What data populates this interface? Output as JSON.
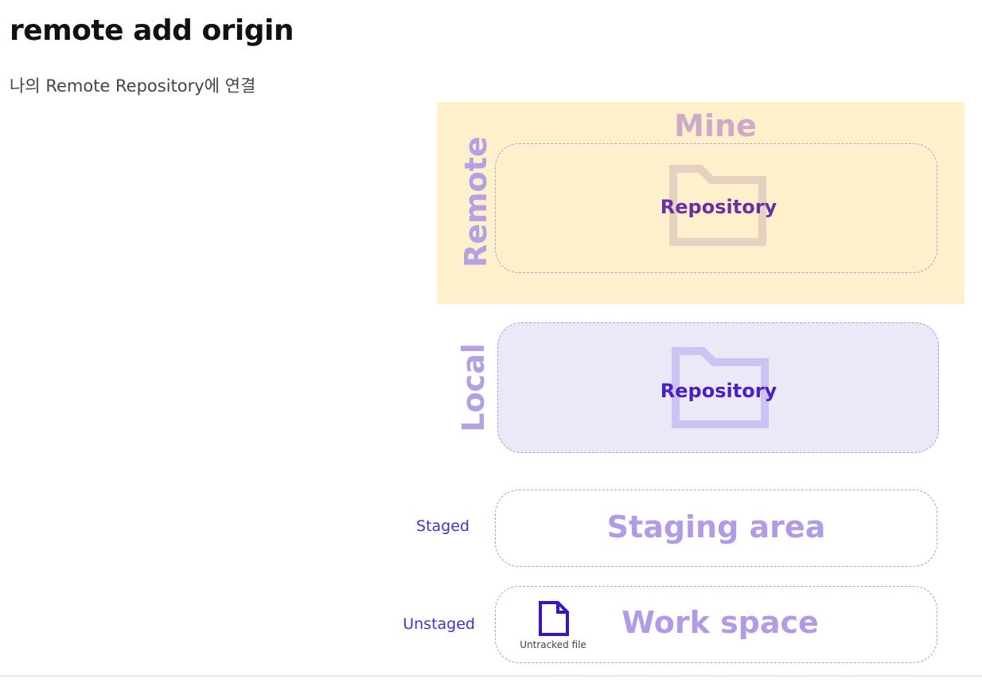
{
  "header": {
    "title": "remote add origin",
    "subtitle": "나의 Remote Repository에 연결"
  },
  "diagram": {
    "mine_label": "Mine",
    "remote": {
      "label": "Remote",
      "repo_label": "Repository"
    },
    "local": {
      "label": "Local",
      "repo_label": "Repository"
    },
    "staging": {
      "label": "Staging area",
      "side_label": "Staged"
    },
    "workspace": {
      "label": "Work space",
      "side_label": "Unstaged",
      "file_caption": "Untracked file"
    },
    "colors": {
      "remote_band": "#fdf0cb",
      "local_fill": "#ebe8f8",
      "dashed_border": "#a99ae6",
      "area_text": "#b19be6",
      "side_text": "#4a2fd0"
    }
  }
}
